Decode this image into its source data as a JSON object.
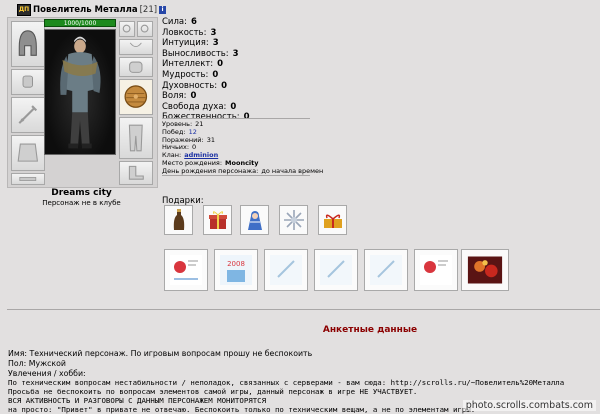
{
  "character": {
    "guild_icon_text": "ДП",
    "name": "Повелитель Металла",
    "level": "[21]",
    "info_icon": "i",
    "hp": "1000/1000",
    "city": "Dreams city",
    "clan_status": "Персонаж не в клубе"
  },
  "stats": [
    {
      "label": "Сила:",
      "value": "6"
    },
    {
      "label": "Ловкость:",
      "value": "3"
    },
    {
      "label": "Интуиция:",
      "value": "3"
    },
    {
      "label": "Выносливость:",
      "value": "3"
    },
    {
      "label": "Интеллект:",
      "value": "0"
    },
    {
      "label": "Мудрость:",
      "value": "0"
    },
    {
      "label": "Духовность:",
      "value": "0"
    },
    {
      "label": "Воля:",
      "value": "0"
    },
    {
      "label": "Свобода духа:",
      "value": "0"
    },
    {
      "label": "Божественность:",
      "value": "0"
    }
  ],
  "info": {
    "level_label": "Уровень:",
    "level_value": "21",
    "wins_label": "Побед:",
    "wins_value": "12",
    "losses_label": "Поражений:",
    "losses_value": "31",
    "draws_label": "Ничьих:",
    "draws_value": "0",
    "clan_label": "Клан:",
    "clan_value": "adminion",
    "birthplace_label": "Место рождения:",
    "birthplace_value": "Mooncity",
    "birthday_label": "День рождения персонажа:",
    "birthday_value": "до начала времен"
  },
  "gifts_label": "Подарки:",
  "profile": {
    "title": "Анкетные данные",
    "lines": [
      "Имя: Технический персонаж. По игровым вопросам прошу не беспокоить",
      "Пол: Мужской",
      "Увлечения / хобби:"
    ],
    "mono_lines": [
      "По техническим вопросам нестабильности / неполадок, связанных с серверами - вам сюда: http://scrolls.ru/~Повелитель%20Металла",
      "Просьба не беспокоить по вопросам элементов самой игры, данный персонаж в игре НЕ УЧАСТВУЕТ.",
      "ВСЯ АКТИВНОСТЬ И РАЗГОВОРЫ С ДАННЫМ ПЕРСОНАЖЕМ МОНИТОРЯТСЯ",
      "на просто: \"Привет\" в привате не отвечаю. Беспокоить только по техническим вещам, а не по элементам игры."
    ]
  },
  "watermark": "photo.scrolls.combats.com"
}
